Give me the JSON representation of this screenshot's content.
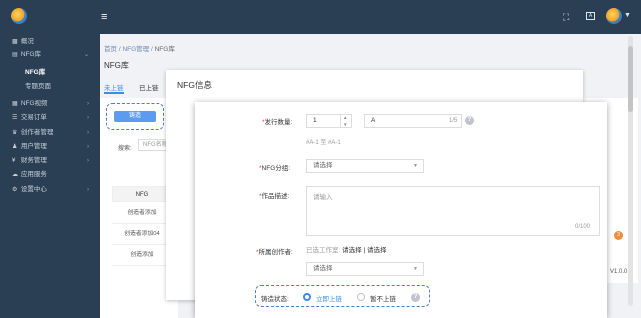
{
  "header": {
    "menu_icon": "hamburger-icon",
    "right_icons": [
      "fullscreen-icon",
      "font-size-icon"
    ]
  },
  "sidebar": {
    "items": [
      {
        "icon": "dashboard-icon",
        "label": "概况"
      },
      {
        "icon": "nfg-icon",
        "label": "NFG库",
        "expanded": true
      },
      {
        "icon": "collection-icon",
        "label": "NFG视频"
      },
      {
        "icon": "order-icon",
        "label": "交易订单"
      },
      {
        "icon": "creator-icon",
        "label": "创作者管理"
      },
      {
        "icon": "user-icon",
        "label": "用户管理"
      },
      {
        "icon": "finance-icon",
        "label": "财务管理"
      },
      {
        "icon": "app-icon",
        "label": "应用服务"
      },
      {
        "icon": "settings-icon",
        "label": "设置中心"
      }
    ],
    "subitems": [
      "NFG库",
      "专题页面"
    ]
  },
  "breadcrumb": {
    "home": "首页",
    "sep": "/",
    "parent": "NFG管理",
    "current": "NFG库"
  },
  "page": {
    "title": "NFG库",
    "tabs": [
      "未上链",
      "已上链"
    ],
    "mint_button": "铸造",
    "search_label": "搜索:",
    "search_placeholder": "NFG名称",
    "table": {
      "header": "NFG",
      "rows": [
        "创造者添加",
        "创造者添加04",
        "创造添加"
      ]
    }
  },
  "back_dialog": {
    "title": "NFG信息"
  },
  "dialog": {
    "issue_qty_label": "发行数量:",
    "issue_qty_value": "1",
    "serial_prefix_value": "A",
    "serial_counter": "1/5",
    "serial_hint": "#A-1 至 #A-1",
    "group_label": "NFG分组:",
    "group_placeholder": "请选择",
    "desc_label": "作品描述:",
    "desc_placeholder": "请输入",
    "desc_counter": "0/100",
    "creator_label": "所属创作者:",
    "creator_prefix": "已选工作室:",
    "creator_select_text": "请选择",
    "creator_sep": "|",
    "creator_select_text2": "请选择",
    "creator_placeholder": "请选择",
    "status_label": "铸造状态:",
    "status_options": [
      "立即上链",
      "暂不上链"
    ],
    "status_selected": 0
  },
  "footer": {
    "version": "V1.0.0",
    "badge": "3"
  },
  "colors": {
    "accent": "#3d8be8",
    "sidebar": "#2a3f53",
    "required": "#e4393c"
  }
}
